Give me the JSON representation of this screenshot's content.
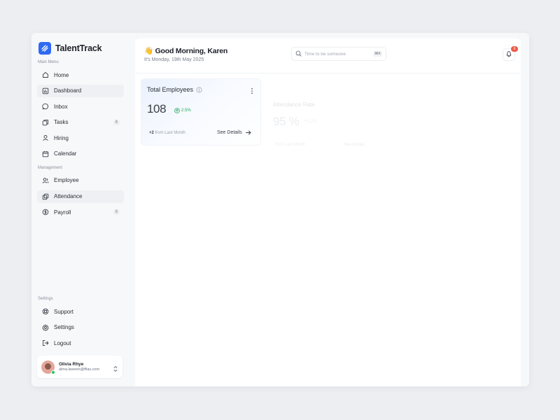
{
  "app": {
    "name": "TalentTrack"
  },
  "sidebar": {
    "main_menu_label": "Main Menu",
    "main_items": [
      {
        "label": "Home",
        "icon": "home-icon"
      },
      {
        "label": "Dashboard",
        "icon": "dashboard-icon",
        "active": true
      },
      {
        "label": "Inbox",
        "icon": "inbox-icon"
      },
      {
        "label": "Tasks",
        "icon": "tasks-icon",
        "count": "8"
      },
      {
        "label": "Hiring",
        "icon": "hiring-icon"
      },
      {
        "label": "Calendar",
        "icon": "calendar-icon"
      }
    ],
    "management_label": "Management",
    "management_items": [
      {
        "label": "Employee",
        "icon": "employee-icon"
      },
      {
        "label": "Attendance",
        "icon": "attendance-icon",
        "active": true
      },
      {
        "label": "Payroll",
        "icon": "payroll-icon",
        "count": "8"
      }
    ],
    "settings_label": "Settings",
    "settings_items": [
      {
        "label": "Support",
        "icon": "support-icon"
      },
      {
        "label": "Settings",
        "icon": "gear-icon"
      },
      {
        "label": "Logout",
        "icon": "logout-icon"
      }
    ],
    "user": {
      "name": "Olivia Rhye",
      "email": "alma.lawson@ffias.com"
    }
  },
  "header": {
    "greeting_emoji": "👋",
    "greeting": "Good Morning, Karen",
    "date": "It's Monday, 19th May 2025",
    "search_placeholder": "Time to be someone",
    "search_shortcut": "⌘K",
    "notification_count": "6"
  },
  "cards": {
    "total_employees": {
      "title": "Total Employees",
      "value": "108",
      "growth": "2.5%",
      "footer_highlight": "+2",
      "footer_text": "from Last Month",
      "link": "See Details"
    },
    "attendance": {
      "title": "Attendance Rate",
      "value": "95 %",
      "growth": "+1.2%",
      "footer": "from Last Month",
      "link": "See Details"
    }
  },
  "colors": {
    "accent": "#2f6af5",
    "success": "#22a55b",
    "danger": "#ef5a48"
  }
}
